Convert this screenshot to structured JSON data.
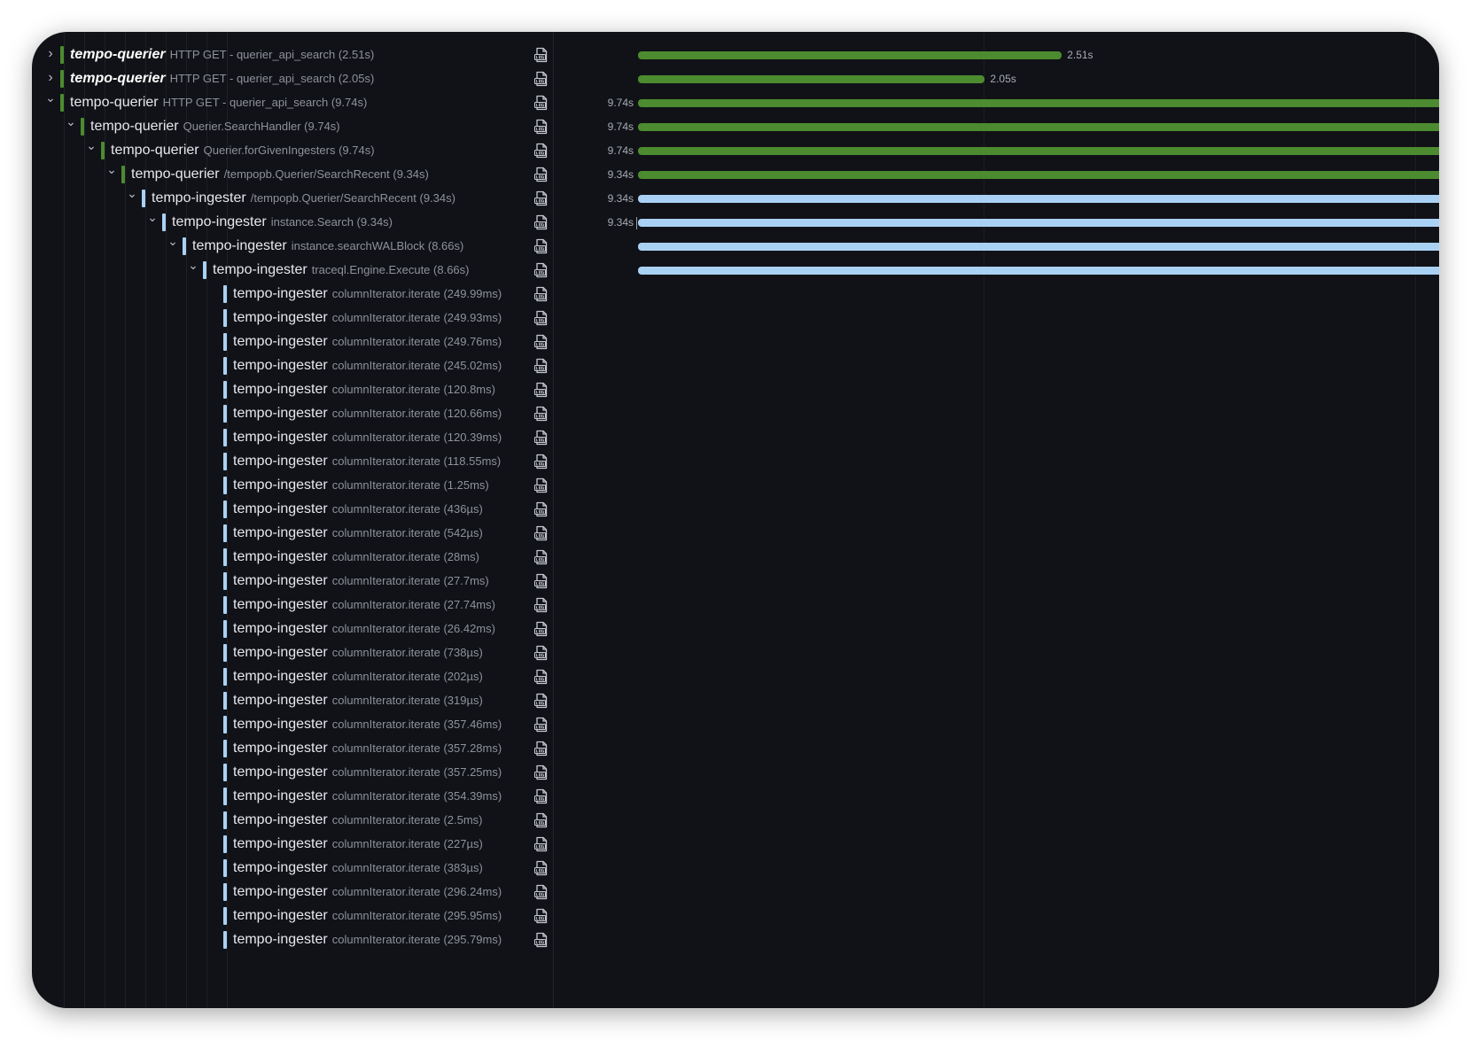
{
  "colors": {
    "querier": "#4c8b2f",
    "ingester": "#a9d1f4"
  },
  "icons": {
    "log": "log-file-icon",
    "expanded": "chevron-down-icon",
    "collapsed": "chevron-right-icon"
  },
  "rows": [
    {
      "service": "tempo-querier",
      "operation": "HTTP GET - querier_api_search (2.51s)",
      "depth": 0,
      "toggle": "collapsed",
      "bold": true,
      "kind": "querier",
      "bar_start": 0,
      "bar_end": 0.529,
      "left_label": "",
      "right_label": "2.51s",
      "tick": false
    },
    {
      "service": "tempo-querier",
      "operation": "HTTP GET - querier_api_search (2.05s)",
      "depth": 0,
      "toggle": "collapsed",
      "bold": true,
      "kind": "querier",
      "bar_start": 0,
      "bar_end": 0.433,
      "left_label": "",
      "right_label": "2.05s",
      "tick": false
    },
    {
      "service": "tempo-querier",
      "operation": "HTTP GET - querier_api_search (9.74s)",
      "depth": 0,
      "toggle": "expanded",
      "bold": false,
      "kind": "querier",
      "bar_start": 0,
      "bar_end": 1,
      "left_label": "9.74s",
      "right_label": "",
      "tick": false
    },
    {
      "service": "tempo-querier",
      "operation": "Querier.SearchHandler (9.74s)",
      "depth": 1,
      "toggle": "expanded",
      "bold": false,
      "kind": "querier",
      "bar_start": 0,
      "bar_end": 1,
      "left_label": "9.74s",
      "right_label": "",
      "tick": false
    },
    {
      "service": "tempo-querier",
      "operation": "Querier.forGivenIngesters (9.74s)",
      "depth": 2,
      "toggle": "expanded",
      "bold": false,
      "kind": "querier",
      "bar_start": 0,
      "bar_end": 1,
      "left_label": "9.74s",
      "right_label": "",
      "tick": false
    },
    {
      "service": "tempo-querier",
      "operation": "/tempopb.Querier/SearchRecent (9.34s)",
      "depth": 3,
      "toggle": "expanded",
      "bold": false,
      "kind": "querier",
      "bar_start": 0,
      "bar_end": 1,
      "left_label": "9.34s",
      "right_label": "",
      "tick": false
    },
    {
      "service": "tempo-ingester",
      "operation": "/tempopb.Querier/SearchRecent (9.34s)",
      "depth": 4,
      "toggle": "expanded",
      "bold": false,
      "kind": "ingester",
      "bar_start": 0,
      "bar_end": 1,
      "left_label": "9.34s",
      "right_label": "",
      "tick": false
    },
    {
      "service": "tempo-ingester",
      "operation": "instance.Search (9.34s)",
      "depth": 5,
      "toggle": "expanded",
      "bold": false,
      "kind": "ingester",
      "bar_start": 0,
      "bar_end": 1,
      "left_label": "9.34s",
      "right_label": "",
      "tick": true
    },
    {
      "service": "tempo-ingester",
      "operation": "instance.searchWALBlock (8.66s)",
      "depth": 6,
      "toggle": "expanded",
      "bold": false,
      "kind": "ingester",
      "bar_start": 0,
      "bar_end": 1,
      "left_label": "",
      "right_label": "",
      "tick": false
    },
    {
      "service": "tempo-ingester",
      "operation": "traceql.Engine.Execute (8.66s)",
      "depth": 7,
      "toggle": "expanded",
      "bold": false,
      "kind": "ingester",
      "bar_start": 0,
      "bar_end": 1,
      "left_label": "",
      "right_label": "",
      "tick": false
    },
    {
      "service": "tempo-ingester",
      "operation": "columnIterator.iterate (249.99ms)",
      "depth": 8,
      "toggle": "none",
      "bold": false,
      "kind": "ingester",
      "bar_start": 0,
      "bar_end": 0,
      "left_label": "",
      "right_label": "",
      "tick": false
    },
    {
      "service": "tempo-ingester",
      "operation": "columnIterator.iterate (249.93ms)",
      "depth": 8,
      "toggle": "none",
      "bold": false,
      "kind": "ingester",
      "bar_start": 0,
      "bar_end": 0,
      "left_label": "",
      "right_label": "",
      "tick": false
    },
    {
      "service": "tempo-ingester",
      "operation": "columnIterator.iterate (249.76ms)",
      "depth": 8,
      "toggle": "none",
      "bold": false,
      "kind": "ingester",
      "bar_start": 0,
      "bar_end": 0,
      "left_label": "",
      "right_label": "",
      "tick": false
    },
    {
      "service": "tempo-ingester",
      "operation": "columnIterator.iterate (245.02ms)",
      "depth": 8,
      "toggle": "none",
      "bold": false,
      "kind": "ingester",
      "bar_start": 0,
      "bar_end": 0,
      "left_label": "",
      "right_label": "",
      "tick": false
    },
    {
      "service": "tempo-ingester",
      "operation": "columnIterator.iterate (120.8ms)",
      "depth": 8,
      "toggle": "none",
      "bold": false,
      "kind": "ingester",
      "bar_start": 0,
      "bar_end": 0,
      "left_label": "",
      "right_label": "",
      "tick": false
    },
    {
      "service": "tempo-ingester",
      "operation": "columnIterator.iterate (120.66ms)",
      "depth": 8,
      "toggle": "none",
      "bold": false,
      "kind": "ingester",
      "bar_start": 0,
      "bar_end": 0,
      "left_label": "",
      "right_label": "",
      "tick": false
    },
    {
      "service": "tempo-ingester",
      "operation": "columnIterator.iterate (120.39ms)",
      "depth": 8,
      "toggle": "none",
      "bold": false,
      "kind": "ingester",
      "bar_start": 0,
      "bar_end": 0,
      "left_label": "",
      "right_label": "",
      "tick": false
    },
    {
      "service": "tempo-ingester",
      "operation": "columnIterator.iterate (118.55ms)",
      "depth": 8,
      "toggle": "none",
      "bold": false,
      "kind": "ingester",
      "bar_start": 0,
      "bar_end": 0,
      "left_label": "",
      "right_label": "",
      "tick": false
    },
    {
      "service": "tempo-ingester",
      "operation": "columnIterator.iterate (1.25ms)",
      "depth": 8,
      "toggle": "none",
      "bold": false,
      "kind": "ingester",
      "bar_start": 0,
      "bar_end": 0,
      "left_label": "",
      "right_label": "",
      "tick": false
    },
    {
      "service": "tempo-ingester",
      "operation": "columnIterator.iterate (436µs)",
      "depth": 8,
      "toggle": "none",
      "bold": false,
      "kind": "ingester",
      "bar_start": 0,
      "bar_end": 0,
      "left_label": "",
      "right_label": "",
      "tick": false
    },
    {
      "service": "tempo-ingester",
      "operation": "columnIterator.iterate (542µs)",
      "depth": 8,
      "toggle": "none",
      "bold": false,
      "kind": "ingester",
      "bar_start": 0,
      "bar_end": 0,
      "left_label": "",
      "right_label": "",
      "tick": false
    },
    {
      "service": "tempo-ingester",
      "operation": "columnIterator.iterate (28ms)",
      "depth": 8,
      "toggle": "none",
      "bold": false,
      "kind": "ingester",
      "bar_start": 0,
      "bar_end": 0,
      "left_label": "",
      "right_label": "",
      "tick": false
    },
    {
      "service": "tempo-ingester",
      "operation": "columnIterator.iterate (27.7ms)",
      "depth": 8,
      "toggle": "none",
      "bold": false,
      "kind": "ingester",
      "bar_start": 0,
      "bar_end": 0,
      "left_label": "",
      "right_label": "",
      "tick": false
    },
    {
      "service": "tempo-ingester",
      "operation": "columnIterator.iterate (27.74ms)",
      "depth": 8,
      "toggle": "none",
      "bold": false,
      "kind": "ingester",
      "bar_start": 0,
      "bar_end": 0,
      "left_label": "",
      "right_label": "",
      "tick": false
    },
    {
      "service": "tempo-ingester",
      "operation": "columnIterator.iterate (26.42ms)",
      "depth": 8,
      "toggle": "none",
      "bold": false,
      "kind": "ingester",
      "bar_start": 0,
      "bar_end": 0,
      "left_label": "",
      "right_label": "",
      "tick": false
    },
    {
      "service": "tempo-ingester",
      "operation": "columnIterator.iterate (738µs)",
      "depth": 8,
      "toggle": "none",
      "bold": false,
      "kind": "ingester",
      "bar_start": 0,
      "bar_end": 0,
      "left_label": "",
      "right_label": "",
      "tick": false
    },
    {
      "service": "tempo-ingester",
      "operation": "columnIterator.iterate (202µs)",
      "depth": 8,
      "toggle": "none",
      "bold": false,
      "kind": "ingester",
      "bar_start": 0,
      "bar_end": 0,
      "left_label": "",
      "right_label": "",
      "tick": false
    },
    {
      "service": "tempo-ingester",
      "operation": "columnIterator.iterate (319µs)",
      "depth": 8,
      "toggle": "none",
      "bold": false,
      "kind": "ingester",
      "bar_start": 0,
      "bar_end": 0,
      "left_label": "",
      "right_label": "",
      "tick": false
    },
    {
      "service": "tempo-ingester",
      "operation": "columnIterator.iterate (357.46ms)",
      "depth": 8,
      "toggle": "none",
      "bold": false,
      "kind": "ingester",
      "bar_start": 0,
      "bar_end": 0,
      "left_label": "",
      "right_label": "",
      "tick": false
    },
    {
      "service": "tempo-ingester",
      "operation": "columnIterator.iterate (357.28ms)",
      "depth": 8,
      "toggle": "none",
      "bold": false,
      "kind": "ingester",
      "bar_start": 0,
      "bar_end": 0,
      "left_label": "",
      "right_label": "",
      "tick": false
    },
    {
      "service": "tempo-ingester",
      "operation": "columnIterator.iterate (357.25ms)",
      "depth": 8,
      "toggle": "none",
      "bold": false,
      "kind": "ingester",
      "bar_start": 0,
      "bar_end": 0,
      "left_label": "",
      "right_label": "",
      "tick": false
    },
    {
      "service": "tempo-ingester",
      "operation": "columnIterator.iterate (354.39ms)",
      "depth": 8,
      "toggle": "none",
      "bold": false,
      "kind": "ingester",
      "bar_start": 0,
      "bar_end": 0,
      "left_label": "",
      "right_label": "",
      "tick": false
    },
    {
      "service": "tempo-ingester",
      "operation": "columnIterator.iterate (2.5ms)",
      "depth": 8,
      "toggle": "none",
      "bold": false,
      "kind": "ingester",
      "bar_start": 0,
      "bar_end": 0,
      "left_label": "",
      "right_label": "",
      "tick": false
    },
    {
      "service": "tempo-ingester",
      "operation": "columnIterator.iterate (227µs)",
      "depth": 8,
      "toggle": "none",
      "bold": false,
      "kind": "ingester",
      "bar_start": 0,
      "bar_end": 0,
      "left_label": "",
      "right_label": "",
      "tick": false
    },
    {
      "service": "tempo-ingester",
      "operation": "columnIterator.iterate (383µs)",
      "depth": 8,
      "toggle": "none",
      "bold": false,
      "kind": "ingester",
      "bar_start": 0,
      "bar_end": 0,
      "left_label": "",
      "right_label": "",
      "tick": false
    },
    {
      "service": "tempo-ingester",
      "operation": "columnIterator.iterate (296.24ms)",
      "depth": 8,
      "toggle": "none",
      "bold": false,
      "kind": "ingester",
      "bar_start": 0,
      "bar_end": 0,
      "left_label": "",
      "right_label": "",
      "tick": false
    },
    {
      "service": "tempo-ingester",
      "operation": "columnIterator.iterate (295.95ms)",
      "depth": 8,
      "toggle": "none",
      "bold": false,
      "kind": "ingester",
      "bar_start": 0,
      "bar_end": 0,
      "left_label": "",
      "right_label": "",
      "tick": false
    },
    {
      "service": "tempo-ingester",
      "operation": "columnIterator.iterate (295.79ms)",
      "depth": 8,
      "toggle": "none",
      "bold": false,
      "kind": "ingester",
      "bar_start": 0,
      "bar_end": 0,
      "left_label": "",
      "right_label": "",
      "tick": false
    }
  ]
}
